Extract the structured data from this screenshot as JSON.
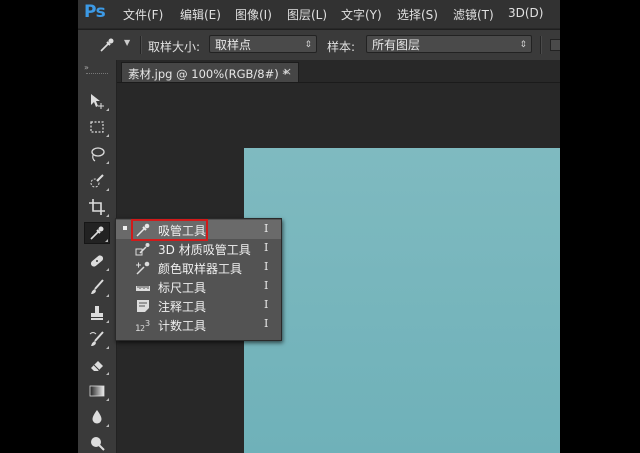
{
  "app": {
    "logo": "Ps"
  },
  "menu": [
    "文件(F)",
    "编辑(E)",
    "图像(I)",
    "图层(L)",
    "文字(Y)",
    "选择(S)",
    "滤镜(T)",
    "3D(D)"
  ],
  "options": {
    "sample_size_label": "取样大小:",
    "sample_size_value": "取样点",
    "sample_label": "样本:",
    "sample_value": "所有图层"
  },
  "document": {
    "tab_title": "素材.jpg @ 100%(RGB/8#) *",
    "close": "×"
  },
  "toolbar": {
    "tools": [
      "move-icon",
      "marquee-icon",
      "lasso-icon",
      "quick-select-icon",
      "crop-icon",
      "eyedropper-icon",
      "healing-brush-icon",
      "brush-icon",
      "clone-stamp-icon",
      "history-brush-icon",
      "eraser-icon",
      "gradient-icon",
      "blur-icon",
      "dodge-icon"
    ],
    "active_tool": "eyedropper-icon"
  },
  "flyout": {
    "items": [
      {
        "label": "吸管工具",
        "shortcut": "I",
        "icon": "eyedropper-icon",
        "selected": true
      },
      {
        "label": "3D 材质吸管工具",
        "shortcut": "I",
        "icon": "3d-material-eyedropper-icon",
        "selected": false
      },
      {
        "label": "颜色取样器工具",
        "shortcut": "I",
        "icon": "color-sampler-icon",
        "selected": false
      },
      {
        "label": "标尺工具",
        "shortcut": "I",
        "icon": "ruler-icon",
        "selected": false
      },
      {
        "label": "注释工具",
        "shortcut": "I",
        "icon": "note-icon",
        "selected": false
      },
      {
        "label": "计数工具",
        "shortcut": "I",
        "icon": "count-icon",
        "selected": false
      }
    ]
  },
  "colors": {
    "canvas": "#7fbac0",
    "highlight": "#d21a1a",
    "logo": "#3c9ae6"
  }
}
